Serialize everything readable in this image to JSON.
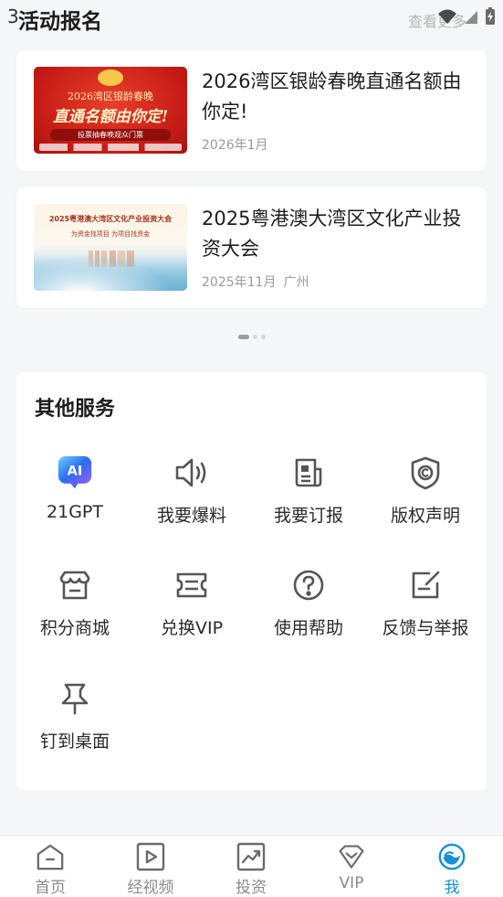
{
  "header": {
    "status_time": "3",
    "title": "活动报名",
    "view_more": "查看更多"
  },
  "events": [
    {
      "title": "2026湾区银龄春晚直通名额由你定!",
      "date": "2026年1月",
      "location": "",
      "thumb": {
        "line1": "2026湾区银龄春晚",
        "line2": "直通名额由你定!",
        "line3": "投票抽春晚观众门票"
      }
    },
    {
      "title": "2025粤港澳大湾区文化产业投资大会",
      "date": "2025年11月",
      "location": "广州",
      "thumb": {
        "line1": "2025粤港澳大湾区文化产业投资大会",
        "line2": "为资金找项目  为项目找资金"
      }
    }
  ],
  "pager": {
    "total": 3,
    "active": 0
  },
  "services": {
    "title": "其他服务",
    "items": [
      {
        "label": "21GPT",
        "icon": "ai-icon"
      },
      {
        "label": "我要爆料",
        "icon": "speaker-icon"
      },
      {
        "label": "我要订报",
        "icon": "newspaper-icon"
      },
      {
        "label": "版权声明",
        "icon": "copyright-shield-icon"
      },
      {
        "label": "积分商城",
        "icon": "store-icon"
      },
      {
        "label": "兑换VIP",
        "icon": "ticket-icon"
      },
      {
        "label": "使用帮助",
        "icon": "help-icon"
      },
      {
        "label": "反馈与举报",
        "icon": "feedback-icon"
      },
      {
        "label": "钉到桌面",
        "icon": "pin-icon"
      }
    ]
  },
  "tabbar": {
    "tabs": [
      {
        "label": "首页",
        "icon": "home-icon"
      },
      {
        "label": "经视频",
        "icon": "video-icon"
      },
      {
        "label": "投资",
        "icon": "chart-icon"
      },
      {
        "label": "VIP",
        "icon": "vip-icon"
      },
      {
        "label": "我",
        "icon": "profile-icon"
      }
    ],
    "active_index": 4,
    "active_color": "#1a8fd8"
  }
}
